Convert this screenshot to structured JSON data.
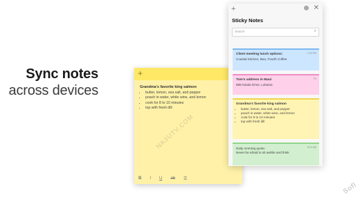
{
  "promo": {
    "line1": "Sync notes",
    "line2": "across devices"
  },
  "note_window": {
    "title": "Grandma's favorite king salmon",
    "items": [
      "butter, lemon, sea salt, and pepper",
      "poach in water, white wine, and lemon",
      "cook for 8 to 10 minutes",
      "top with fresh dill"
    ],
    "toolbar": [
      "B",
      "I",
      "U",
      "ab",
      "☰"
    ]
  },
  "app": {
    "title": "Sticky Notes",
    "search_placeholder": "Search",
    "notes": [
      {
        "color": "#cce6ff",
        "title": "Client meeting lunch options:",
        "text": "Coastal Kitchen, Bea, Fourth Coffee",
        "time": "1:20 PM"
      },
      {
        "color": "#ffd0ea",
        "title": "Tom's address in Maui",
        "text": "888 Kaiula Drive, Lahaina",
        "time": "Fri"
      },
      {
        "color": "#fff4b3",
        "title": "Grandma's favorite king salmon",
        "items": [
          "butter, lemon, sea salt, and pepper",
          "poach in water, white wine, and lemon",
          "cook for 8 to 10 minutes",
          "top with fresh dill"
        ]
      },
      {
        "color": "#d2f0cf",
        "title": "Daily morning quote:",
        "text": "Never be afraid to sit awhile and think",
        "time": "8:10 AM"
      }
    ]
  },
  "watermarks": {
    "diagonal": "NAЗUTV.COM",
    "corner": "Sofl"
  }
}
